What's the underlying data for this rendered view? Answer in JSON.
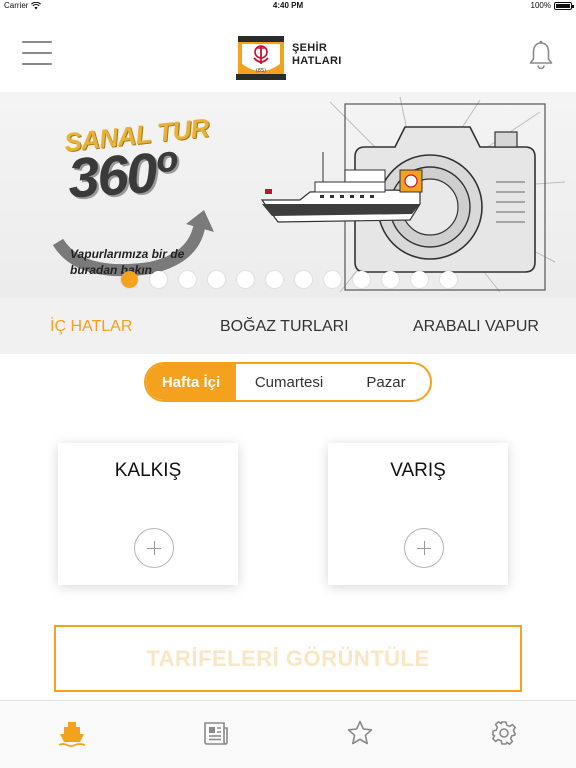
{
  "status_bar": {
    "carrier": "Carrier",
    "time": "4:40 PM",
    "battery_text": "100%",
    "battery_level": 1.0
  },
  "header": {
    "logo_line1": "ŞEHİR",
    "logo_line2": "HATLARI",
    "logo_badge": "(85)"
  },
  "banner": {
    "title_line1": "SANAL TUR",
    "title_line2": "360º",
    "subtitle": "Vapurlarımıza bir de buradan bakın.",
    "slide_count": 12,
    "active_slide": 1
  },
  "line_tabs": [
    {
      "label": "İÇ HATLAR",
      "active": true
    },
    {
      "label": "BOĞAZ TURLARI",
      "active": false
    },
    {
      "label": "ARABALI VAPUR",
      "active": false
    }
  ],
  "day_selector": {
    "options": [
      {
        "label": "Hafta İçi",
        "active": true
      },
      {
        "label": "Cumartesi",
        "active": false
      },
      {
        "label": "Pazar",
        "active": false
      }
    ]
  },
  "stations": {
    "departure_label": "KALKIŞ",
    "arrival_label": "VARIŞ"
  },
  "view_button": {
    "label": "TARİFELERİ GÖRÜNTÜLE"
  },
  "tab_bar": [
    {
      "icon": "ferry-icon",
      "active": true
    },
    {
      "icon": "news-icon",
      "active": false
    },
    {
      "icon": "star-icon",
      "active": false
    },
    {
      "icon": "gear-icon",
      "active": false
    }
  ],
  "colors": {
    "accent": "#f4a21e",
    "accent_light": "#fbe6c4",
    "inactive_icon": "#8a8a8a",
    "tab_background": "#f1f1f1"
  }
}
